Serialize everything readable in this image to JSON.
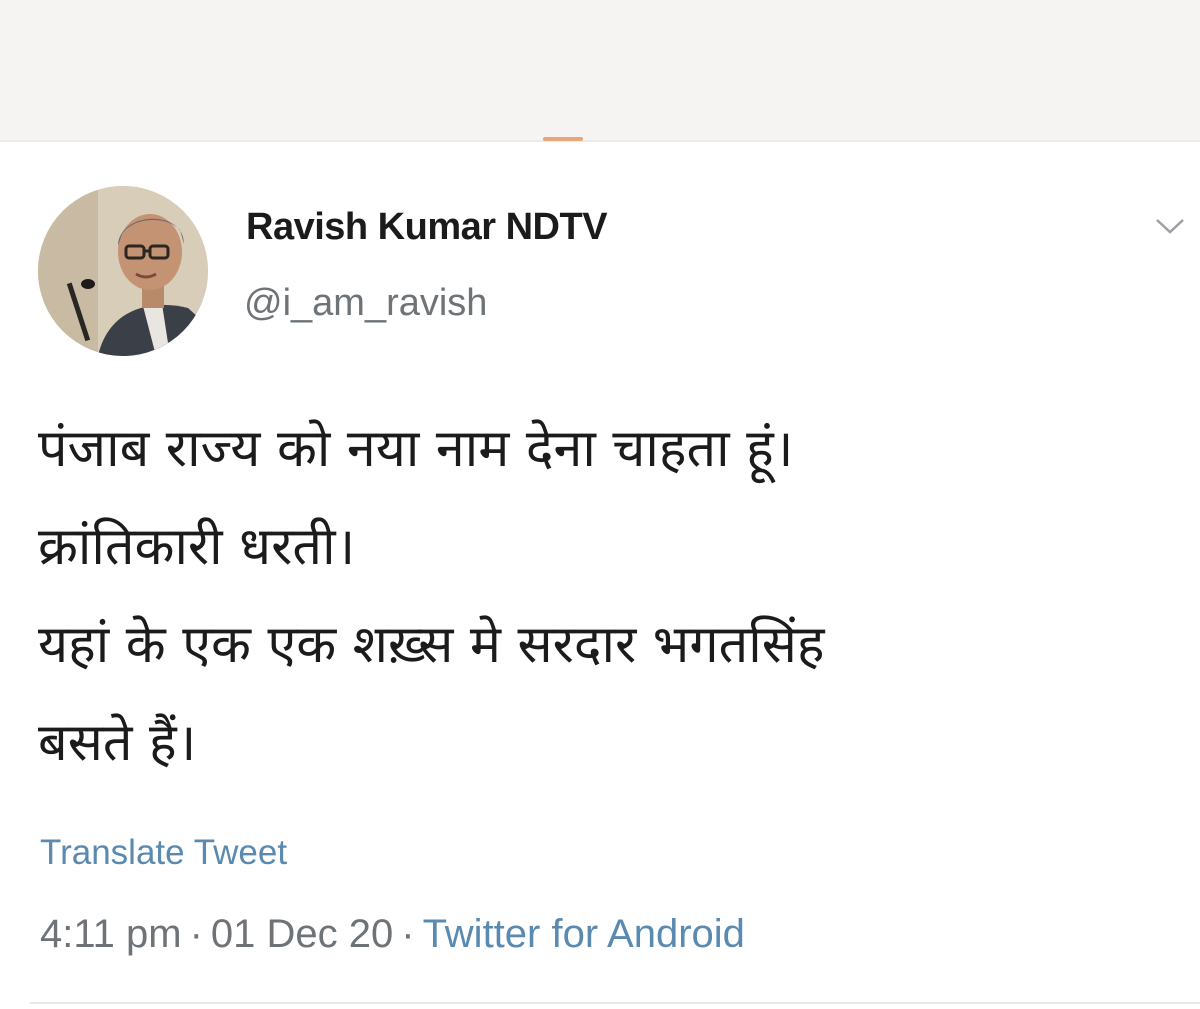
{
  "tweet": {
    "author": {
      "display_name": "Ravish Kumar NDTV",
      "handle": "@i_am_ravish"
    },
    "text_lines": [
      "पंजाब राज्य को नया नाम देना चाहता हूं।",
      "क्रांतिकारी धरती।",
      "यहां के एक एक शख़्स मे सरदार भगतसिंह",
      "बसते हैं।"
    ],
    "translate_label": "Translate Tweet",
    "meta": {
      "time": "4:11 pm",
      "separator": "·",
      "date": "01 Dec 20",
      "source": "Twitter for Android"
    }
  },
  "icons": {
    "menu": "chevron-down-icon",
    "avatar": "profile-photo"
  },
  "colors": {
    "link": "#5a8ab0",
    "secondary_text": "#6e7378",
    "primary_text": "#1b1b1b",
    "top_band": "#f6f4f2",
    "handle_accent": "#e6a57a"
  }
}
